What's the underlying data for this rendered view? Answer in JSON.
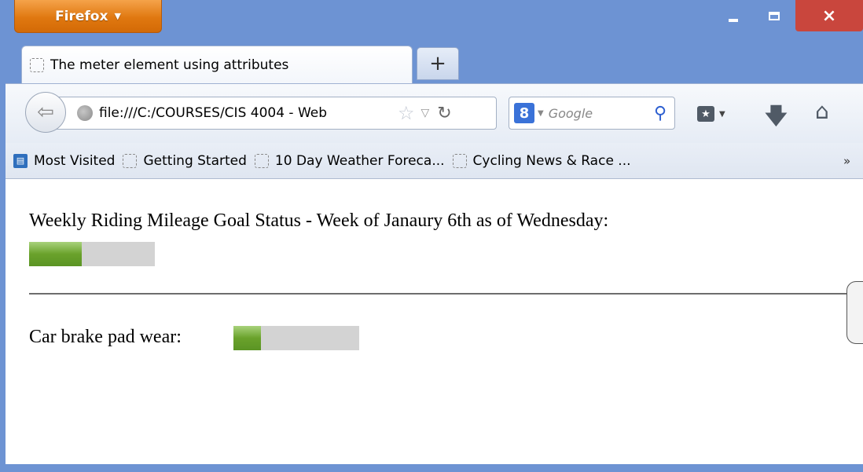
{
  "window": {
    "app_menu_label": "Firefox",
    "minimize_glyph": "_",
    "close_glyph": "×"
  },
  "tabs": [
    {
      "label": "The meter element using attributes"
    }
  ],
  "new_tab_glyph": "+",
  "navbar": {
    "url": "file:///C:/COURSES/CIS 4004 - Web",
    "search_placeholder": "Google",
    "search_engine_glyph": "8"
  },
  "bookmarks": [
    {
      "label": "Most Visited"
    },
    {
      "label": "Getting Started"
    },
    {
      "label": "10 Day Weather Foreca..."
    },
    {
      "label": "Cycling News & Race ..."
    }
  ],
  "bookmarks_overflow": "»",
  "content": {
    "goal_label": "Weekly Riding Mileage Goal Status - Week of Janaury 6th as of Wednesday:",
    "goal_meter_fraction": 0.42,
    "brake_label": "Car brake pad wear:",
    "brake_meter_fraction": 0.22
  },
  "colors": {
    "meter_fill": "#6aa22b",
    "meter_track": "#d3d3d3",
    "titlebar": "#6d93d3",
    "close_button": "#c9463d",
    "firefox_button": "#e07810"
  }
}
